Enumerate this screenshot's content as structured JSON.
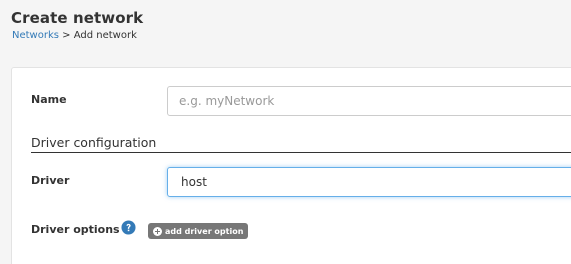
{
  "header": {
    "title": "Create network",
    "breadcrumb": {
      "parent": "Networks",
      "separator": ">",
      "current": "Add network"
    }
  },
  "form": {
    "name": {
      "label": "Name",
      "placeholder": "e.g. myNetwork",
      "value": ""
    },
    "driver_section": {
      "title": "Driver configuration"
    },
    "driver": {
      "label": "Driver",
      "value": "host"
    },
    "driver_options": {
      "label": "Driver options",
      "help_icon": "question-circle-icon",
      "add_button_label": "add driver option",
      "add_button_icon": "plus-circle-icon"
    }
  },
  "colors": {
    "link": "#337ab7",
    "help_icon": "#337ab7",
    "add_button_bg": "#777777",
    "focus_border": "#66afe9"
  }
}
